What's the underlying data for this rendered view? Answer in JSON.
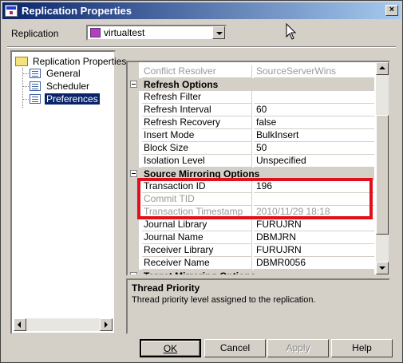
{
  "window": {
    "title": "Replication Properties",
    "close_glyph": "×"
  },
  "replication": {
    "label": "Replication",
    "selected": "virtualtest"
  },
  "tree": {
    "root": "Replication Properties",
    "items": [
      {
        "label": "General",
        "selected": false
      },
      {
        "label": "Scheduler",
        "selected": false
      },
      {
        "label": "Preferences",
        "selected": true
      }
    ]
  },
  "grid": {
    "rows": [
      {
        "type": "prop",
        "name": "Conflict Resolver",
        "value": "SourceServerWins",
        "disabled": true
      },
      {
        "type": "cat",
        "name": "Refresh Options"
      },
      {
        "type": "prop",
        "name": "Refresh Filter",
        "value": ""
      },
      {
        "type": "prop",
        "name": "Refresh Interval",
        "value": "60"
      },
      {
        "type": "prop",
        "name": "Refresh Recovery",
        "value": "false"
      },
      {
        "type": "prop",
        "name": "Insert Mode",
        "value": "BulkInsert"
      },
      {
        "type": "prop",
        "name": "Block Size",
        "value": "50"
      },
      {
        "type": "prop",
        "name": "Isolation Level",
        "value": "Unspecified"
      },
      {
        "type": "cat",
        "name": "Source Mirroring Options"
      },
      {
        "type": "prop",
        "name": "Transaction ID",
        "value": "196"
      },
      {
        "type": "prop",
        "name": "Commit TID",
        "value": "",
        "disabled": true
      },
      {
        "type": "prop",
        "name": "Transaction Timestamp",
        "value": "2010/11/29 18:18",
        "disabled": true
      },
      {
        "type": "prop",
        "name": "Journal Library",
        "value": "FURUJRN"
      },
      {
        "type": "prop",
        "name": "Journal Name",
        "value": "DBMJRN"
      },
      {
        "type": "prop",
        "name": "Receiver Library",
        "value": "FURUJRN"
      },
      {
        "type": "prop",
        "name": "Receiver Name",
        "value": "DBMR0056"
      },
      {
        "type": "cat",
        "name": "Target Mirroring Options"
      }
    ]
  },
  "description": {
    "title": "Thread Priority",
    "text": "Thread priority level assigned to the replication."
  },
  "buttons": {
    "ok": "OK",
    "cancel": "Cancel",
    "apply": "Apply",
    "help": "Help"
  },
  "colors": {
    "highlight": "#e0101c",
    "selection": "#0a246a",
    "dialog": "#d4d0c8"
  }
}
